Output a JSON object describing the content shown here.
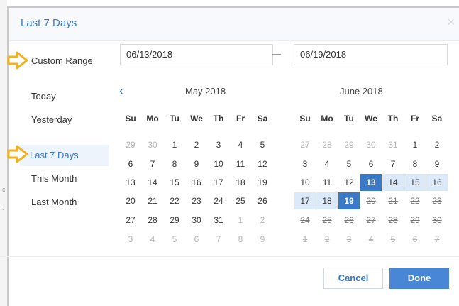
{
  "dialog": {
    "title": "Last 7 Days",
    "close": "×"
  },
  "presets": [
    {
      "label": "Custom Range"
    },
    {
      "label": "Today"
    },
    {
      "label": "Yesterday"
    },
    {
      "label": "Last 7 Days",
      "active": true
    },
    {
      "label": "This Month"
    },
    {
      "label": "Last Month"
    }
  ],
  "inputs": {
    "start": "06/13/2018",
    "end": "06/19/2018"
  },
  "weekdays": [
    "Su",
    "Mo",
    "Tu",
    "We",
    "Th",
    "Fr",
    "Sa"
  ],
  "calendars": [
    {
      "title": "May 2018",
      "prev_icon": "‹",
      "weeks": [
        [
          [
            "29",
            "o"
          ],
          [
            "30",
            "o"
          ],
          [
            "1",
            ""
          ],
          [
            "2",
            ""
          ],
          [
            "3",
            ""
          ],
          [
            "4",
            ""
          ],
          [
            "5",
            ""
          ]
        ],
        [
          [
            "6",
            ""
          ],
          [
            "7",
            ""
          ],
          [
            "8",
            ""
          ],
          [
            "9",
            ""
          ],
          [
            "10",
            ""
          ],
          [
            "11",
            ""
          ],
          [
            "12",
            ""
          ]
        ],
        [
          [
            "13",
            ""
          ],
          [
            "14",
            ""
          ],
          [
            "15",
            ""
          ],
          [
            "16",
            ""
          ],
          [
            "17",
            ""
          ],
          [
            "18",
            ""
          ],
          [
            "19",
            ""
          ]
        ],
        [
          [
            "20",
            ""
          ],
          [
            "21",
            ""
          ],
          [
            "22",
            ""
          ],
          [
            "23",
            ""
          ],
          [
            "24",
            ""
          ],
          [
            "25",
            ""
          ],
          [
            "26",
            ""
          ]
        ],
        [
          [
            "27",
            ""
          ],
          [
            "28",
            ""
          ],
          [
            "29",
            ""
          ],
          [
            "30",
            ""
          ],
          [
            "31",
            ""
          ],
          [
            "1",
            "o"
          ],
          [
            "2",
            "o"
          ]
        ],
        [
          [
            "3",
            "o"
          ],
          [
            "4",
            "o"
          ],
          [
            "5",
            "o"
          ],
          [
            "6",
            "o"
          ],
          [
            "7",
            "o"
          ],
          [
            "8",
            "o"
          ],
          [
            "9",
            "o"
          ]
        ]
      ]
    },
    {
      "title": "June 2018",
      "weeks": [
        [
          [
            "27",
            "o"
          ],
          [
            "28",
            "o"
          ],
          [
            "29",
            "o"
          ],
          [
            "30",
            "o"
          ],
          [
            "31",
            "o"
          ],
          [
            "1",
            ""
          ],
          [
            "2",
            ""
          ]
        ],
        [
          [
            "3",
            ""
          ],
          [
            "4",
            ""
          ],
          [
            "5",
            ""
          ],
          [
            "6",
            ""
          ],
          [
            "7",
            ""
          ],
          [
            "8",
            ""
          ],
          [
            "9",
            ""
          ]
        ],
        [
          [
            "10",
            ""
          ],
          [
            "11",
            ""
          ],
          [
            "12",
            ""
          ],
          [
            "13",
            "s"
          ],
          [
            "14",
            "r"
          ],
          [
            "15",
            "r"
          ],
          [
            "16",
            "r"
          ]
        ],
        [
          [
            "17",
            "r"
          ],
          [
            "18",
            "r"
          ],
          [
            "19",
            "s"
          ],
          [
            "20",
            "d"
          ],
          [
            "21",
            "d"
          ],
          [
            "22",
            "d"
          ],
          [
            "23",
            "d"
          ]
        ],
        [
          [
            "24",
            "d"
          ],
          [
            "25",
            "d"
          ],
          [
            "26",
            "d"
          ],
          [
            "27",
            "d"
          ],
          [
            "28",
            "d"
          ],
          [
            "29",
            "d"
          ],
          [
            "30",
            "d"
          ]
        ],
        [
          [
            "1",
            "do"
          ],
          [
            "2",
            "do"
          ],
          [
            "3",
            "do"
          ],
          [
            "4",
            "do"
          ],
          [
            "5",
            "do"
          ],
          [
            "6",
            "do"
          ],
          [
            "7",
            "do"
          ]
        ]
      ]
    }
  ],
  "buttons": {
    "cancel": "Cancel",
    "done": "Done"
  },
  "colors": {
    "accent": "#3a78c8",
    "range": "#dce9f8",
    "arrow": "#f2b21a"
  }
}
